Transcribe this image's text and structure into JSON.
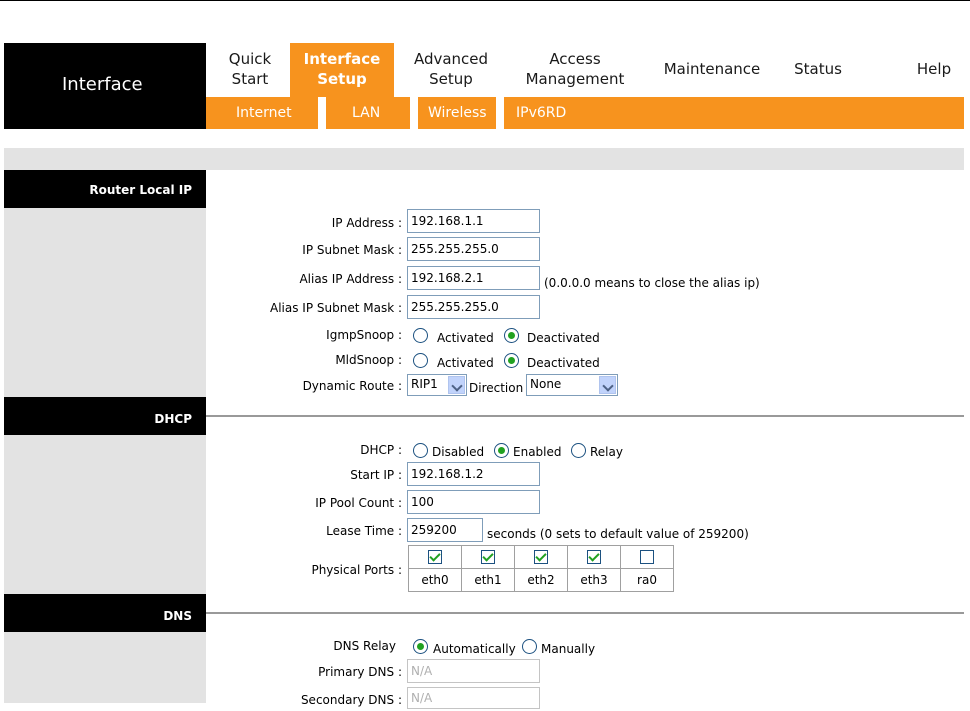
{
  "brand": "Interface",
  "menu": [
    {
      "line1": "Quick",
      "line2": "Start"
    },
    {
      "line1": "Interface",
      "line2": "Setup"
    },
    {
      "line1": "Advanced",
      "line2": "Setup"
    },
    {
      "line1": "Access",
      "line2": "Management"
    },
    {
      "line1": "Maintenance",
      "line2": ""
    },
    {
      "line1": "Status",
      "line2": ""
    },
    {
      "line1": "Help",
      "line2": ""
    }
  ],
  "submenu": [
    "Internet",
    "LAN",
    "Wireless",
    "IPv6RD"
  ],
  "sections": {
    "router": "Router Local IP",
    "dhcp": "DHCP",
    "dns": "DNS"
  },
  "router": {
    "ip_label": "IP Address :",
    "ip_value": "192.168.1.1",
    "mask_label": "IP Subnet Mask :",
    "mask_value": "255.255.255.0",
    "alias_ip_label": "Alias IP Address :",
    "alias_ip_value": "192.168.2.1",
    "alias_note": "(0.0.0.0 means to close the alias ip)",
    "alias_mask_label": "Alias IP Subnet Mask :",
    "alias_mask_value": "255.255.255.0",
    "igmp_label": "IgmpSnoop :",
    "mld_label": "MldSnoop :",
    "activated": "Activated",
    "deactivated": "Deactivated",
    "route_label": "Dynamic Route :",
    "route_value": "RIP1",
    "direction_label": "Direction",
    "direction_value": "None"
  },
  "dhcp": {
    "dhcp_label": "DHCP :",
    "opt_disabled": "Disabled",
    "opt_enabled": "Enabled",
    "opt_relay": "Relay",
    "start_label": "Start IP :",
    "start_value": "192.168.1.2",
    "pool_label": "IP Pool Count :",
    "pool_value": "100",
    "lease_label": "Lease Time :",
    "lease_value": "259200",
    "lease_note": "seconds (0 sets to default value of 259200)",
    "ports_label": "Physical Ports :",
    "ports": [
      "eth0",
      "eth1",
      "eth2",
      "eth3",
      "ra0"
    ]
  },
  "dns": {
    "relay_label": "DNS Relay",
    "opt_auto": "Automatically",
    "opt_manual": "Manually",
    "primary_label": "Primary DNS :",
    "primary_value": "N/A",
    "secondary_label": "Secondary DNS :",
    "secondary_value": "N/A"
  },
  "colors": {
    "accent": "#f7931e",
    "panel": "#e3e3e3",
    "check": "#21a121"
  }
}
